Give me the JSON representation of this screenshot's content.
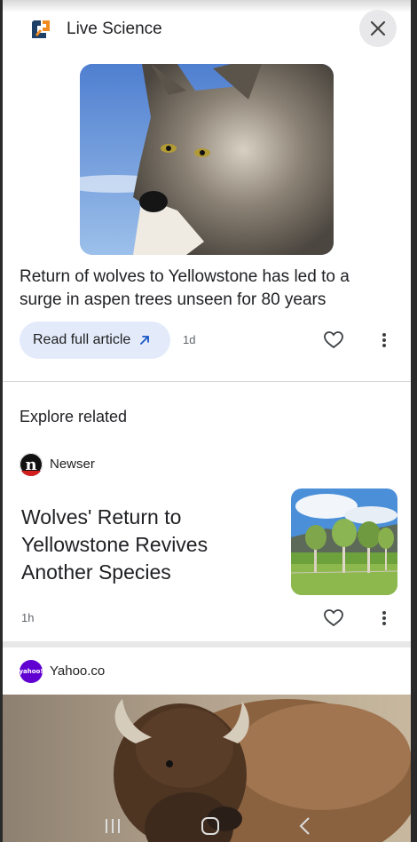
{
  "source": {
    "name": "Live Science",
    "icon": "live-science-logo"
  },
  "close_icon": "close-icon",
  "main_article": {
    "title": "Return of wolves to Yellowstone has led to a surge in aspen trees unseen for 80 years",
    "read_button": "Read full article",
    "age": "1d"
  },
  "explore": {
    "heading": "Explore related"
  },
  "related": [
    {
      "publisher": "Newser",
      "publisher_logo_letter": "n",
      "title": "Wolves' Return to Yellowstone Revives Another Species",
      "age": "1h"
    },
    {
      "publisher": "Yahoo.co",
      "publisher_logo_text": "yahoo!"
    }
  ],
  "colors": {
    "accent_button_bg": "#e3ebfb",
    "link_arrow": "#1a56c4",
    "yahoo_purple": "#6001d2",
    "newser_red": "#d41e1e"
  }
}
